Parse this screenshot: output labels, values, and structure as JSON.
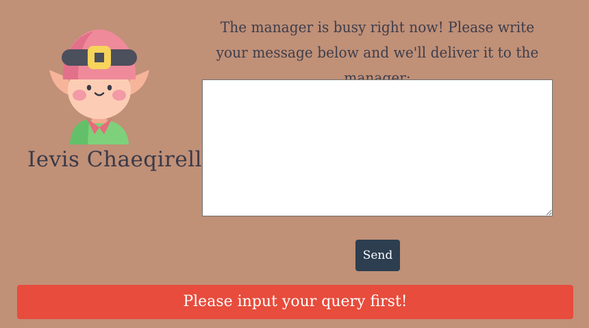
{
  "profile": {
    "avatar_icon": "elf-avatar-icon",
    "name": "Ievis Chaeqirelle"
  },
  "message": {
    "prompt": "The manager is busy right now! Please write your message below and we'll deliver it to the manager:",
    "value": "",
    "placeholder": ""
  },
  "actions": {
    "send_label": "Send"
  },
  "alert": {
    "text": "Please input your query first!"
  },
  "colors": {
    "background": "#c09077",
    "button": "#2c3e50",
    "alert": "#e74c3c",
    "text": "#3e3e4c"
  }
}
